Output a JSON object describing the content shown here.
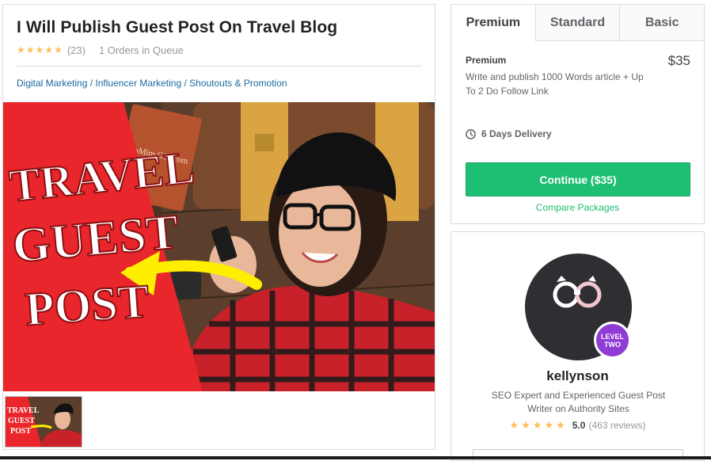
{
  "gig": {
    "title": "I Will Publish Guest Post On Travel Blog",
    "rating_count": "(23)",
    "queue": "1 Orders in Queue",
    "breadcrumb": [
      "Digital Marketing",
      "Influencer Marketing",
      "Shoutouts & Promotion"
    ],
    "image": {
      "banner_lines": [
        "TRAVEL",
        "GUEST",
        "POST"
      ],
      "notebook_text": "aMim Girl.com"
    }
  },
  "packages": {
    "tabs": [
      "Premium",
      "Standard",
      "Basic"
    ],
    "active_tab": "Premium",
    "name": "Premium",
    "price": "$35",
    "description": "Write and publish 1000 Words article + Up To 2 Do Follow Link",
    "delivery": "6 Days Delivery",
    "continue_label": "Continue ($35)",
    "compare_label": "Compare Packages"
  },
  "seller": {
    "name": "kellynson",
    "level_line1": "LEVEL",
    "level_line2": "TWO",
    "bio": "SEO Expert and Experienced Guest Post Writer on Authority Sites",
    "score": "5.0",
    "reviews": "(463 reviews)"
  },
  "colors": {
    "accent_green": "#1dbf73",
    "star": "#ffbe5b",
    "link_blue": "#1d6aa1",
    "level_purple": "#8f3bd6",
    "banner_red": "#e8262c"
  }
}
